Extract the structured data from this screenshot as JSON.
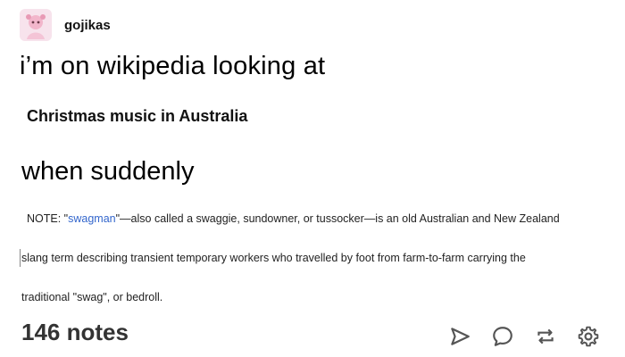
{
  "post": {
    "username": "gojikas",
    "line1": "i’m on wikipedia looking at",
    "screenshot_title": "Christmas music in Australia",
    "line2": "when suddenly",
    "note": {
      "prefix": "NOTE: \"",
      "link": "swagman",
      "line1_rest": "\"—also called a swaggie, sundowner, or tussocker—is an old Australian and New Zealand",
      "line2": "slang term describing transient temporary workers who travelled by foot from farm-to-farm carrying the",
      "line3": "traditional \"swag\", or bedroll."
    },
    "notes_count": "146 notes"
  },
  "icons": {
    "share": "share-icon",
    "reply": "reply-icon",
    "reblog": "reblog-icon",
    "settings": "gear-icon"
  },
  "colors": {
    "link": "#3366cc",
    "notes": "#333333"
  }
}
